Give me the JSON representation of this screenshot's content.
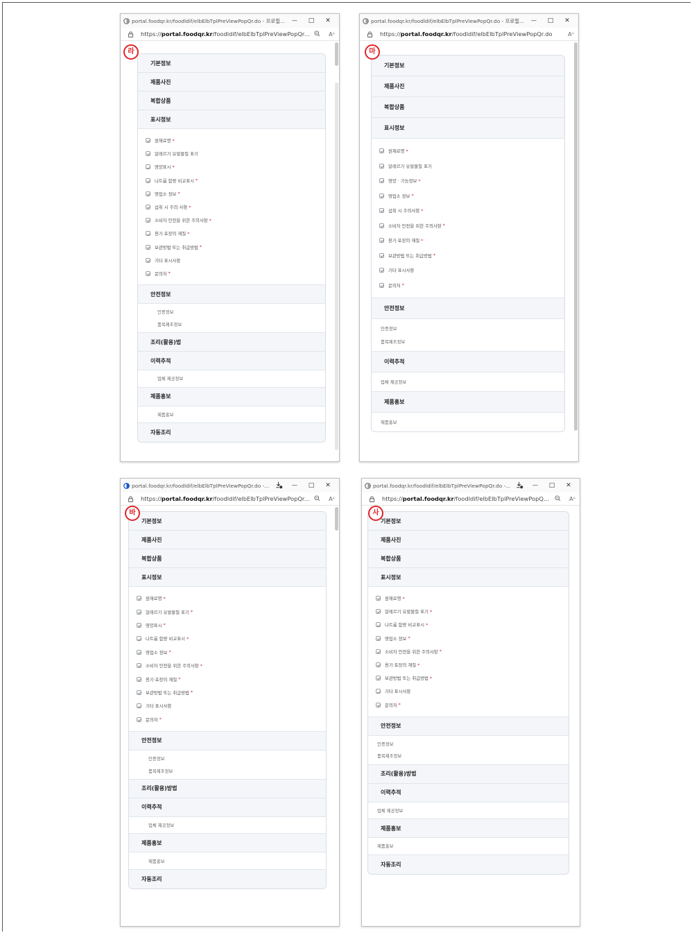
{
  "windows": [
    {
      "badge": "라",
      "title": "portal.foodqr.kr/foodldif/elbElbTplPreViewPopQr.do - 프로필...",
      "url_prefix": "https://",
      "url_host": "portal.foodqr.kr",
      "url_path": "/foodldif/elbElbTplPreViewPopQr....",
      "show_download": false,
      "sections": [
        {
          "title": "기본정보"
        },
        {
          "title": "제품사진"
        },
        {
          "title": "복합상품"
        },
        {
          "title": "표시정보",
          "items": [
            {
              "label": "원재료명",
              "star": "*"
            },
            {
              "label": "알레르기 유발물질 표기",
              "star": ""
            },
            {
              "label": "영양표시",
              "star": "*"
            },
            {
              "label": "나트륨 함량 비교표시",
              "star": "*"
            },
            {
              "label": "영업소 정보",
              "star": "*"
            },
            {
              "label": "섭취 시 주의 사항",
              "star": "*"
            },
            {
              "label": "소비자 안전을 위한 주의사항",
              "star": "*"
            },
            {
              "label": "용기·포장의 재질",
              "star": "*"
            },
            {
              "label": "보관방법 또는 취급방법",
              "star": "*"
            },
            {
              "label": "기타 표시사항",
              "star": ""
            },
            {
              "label": "문의처",
              "star": "*"
            }
          ]
        },
        {
          "title": "안전정보",
          "plain": [
            "인증정보",
            "품목제조정보"
          ]
        },
        {
          "title": "조리(활용)법"
        },
        {
          "title": "이력추적",
          "plain": [
            "업체 제공정보"
          ]
        },
        {
          "title": "제품홍보",
          "plain": [
            "제품홍보"
          ]
        },
        {
          "title": "자동조리"
        }
      ]
    },
    {
      "badge": "마",
      "title": "portal.foodqr.kr/foodldif/elbElbTplPreViewPopQr.do - 프로필...",
      "url_prefix": "https://",
      "url_host": "portal.foodqr.kr",
      "url_path": "/foodldif/elbElbTplPreViewPopQr.do",
      "show_download": false,
      "sections": [
        {
          "title": "기본정보"
        },
        {
          "title": "제품사진"
        },
        {
          "title": "복합상품"
        },
        {
          "title": "표시정보",
          "items": [
            {
              "label": "원재료명",
              "star": "*"
            },
            {
              "label": "알레르기 유발물질 표기",
              "star": ""
            },
            {
              "label": "영양 · 기능정보",
              "star": "*"
            },
            {
              "label": "영업소 정보",
              "star": "*"
            },
            {
              "label": "섭취 시 주의사항",
              "star": "*"
            },
            {
              "label": "소비자 안전을 위한 주의사항",
              "star": "*"
            },
            {
              "label": "용기·포장의 재질",
              "star": "*"
            },
            {
              "label": "보관방법 또는 취급방법",
              "star": "*"
            },
            {
              "label": "기타 표시사항",
              "star": ""
            },
            {
              "label": "문의처",
              "star": "*"
            }
          ]
        },
        {
          "title": "안전정보",
          "plain": [
            "인증정보",
            "품목제조정보"
          ]
        },
        {
          "title": "이력추적",
          "plain": [
            "업체 제공정보"
          ]
        },
        {
          "title": "제품홍보",
          "plain": [
            "제품홍보"
          ]
        }
      ]
    },
    {
      "badge": "바",
      "title": "portal.foodqr.kr/foodldif/elbElbTplPreViewPopQr.do -...",
      "url_prefix": "https://",
      "url_host": "portal.foodqr.kr",
      "url_path": "/foodldif/elbElbTplPreViewPopQr....",
      "show_download": true,
      "sections": [
        {
          "title": "기본정보"
        },
        {
          "title": "제품사진"
        },
        {
          "title": "복합상품"
        },
        {
          "title": "표시정보",
          "items": [
            {
              "label": "원재료명",
              "star": "*"
            },
            {
              "label": "알레르기 유발물질 표기",
              "star": "*"
            },
            {
              "label": "영양표시",
              "star": "*"
            },
            {
              "label": "나트륨 함량 비교표시",
              "star": "*"
            },
            {
              "label": "영업소 정보",
              "star": "*"
            },
            {
              "label": "소비자 안전을 위한 주의사항",
              "star": "*"
            },
            {
              "label": "용기·포장의 재질",
              "star": "*"
            },
            {
              "label": "보관방법 또는 취급방법",
              "star": "*"
            },
            {
              "label": "기타 표시사항",
              "star": ""
            },
            {
              "label": "문의처",
              "star": "*"
            }
          ]
        },
        {
          "title": "안전정보",
          "plain": [
            "인증정보",
            "품목제조정보"
          ]
        },
        {
          "title": "조리(활용)방법"
        },
        {
          "title": "이력추적",
          "plain": [
            "업체 제공정보"
          ]
        },
        {
          "title": "제품홍보",
          "plain": [
            "제품홍보"
          ]
        },
        {
          "title": "자동조리"
        }
      ]
    },
    {
      "badge": "사",
      "title": "portal.foodqr.kr/foodldif/elbElbTplPreViewPopQr.do -...",
      "url_prefix": "https://",
      "url_host": "portal.foodqr.kr",
      "url_path": "/foodldif/elbElbTplPreViewPopQr....",
      "show_download": true,
      "sections": [
        {
          "title": "기본정보"
        },
        {
          "title": "제품사진"
        },
        {
          "title": "복합상품"
        },
        {
          "title": "표시정보",
          "items": [
            {
              "label": "원재료명",
              "star": "*"
            },
            {
              "label": "알레르기 유발물질 표기",
              "star": "*"
            },
            {
              "label": "나트륨 함량 비교표시",
              "star": "*"
            },
            {
              "label": "영업소 정보",
              "star": "*"
            },
            {
              "label": "소비자 안전을 위한 주의사항",
              "star": "*"
            },
            {
              "label": "용기·포장의 재질",
              "star": "*"
            },
            {
              "label": "보관방법 또는 취급방법",
              "star": "*"
            },
            {
              "label": "기타 표시사항",
              "star": ""
            },
            {
              "label": "문의처",
              "star": "*"
            }
          ]
        },
        {
          "title": "안전정보",
          "plain": [
            "인증정보",
            "품목제조정보"
          ]
        },
        {
          "title": "조리(활용)방법"
        },
        {
          "title": "이력추적",
          "plain": [
            "업체 제공정보"
          ]
        },
        {
          "title": "제품홍보",
          "plain": [
            "제품홍보"
          ]
        },
        {
          "title": "자동조리"
        }
      ]
    }
  ]
}
